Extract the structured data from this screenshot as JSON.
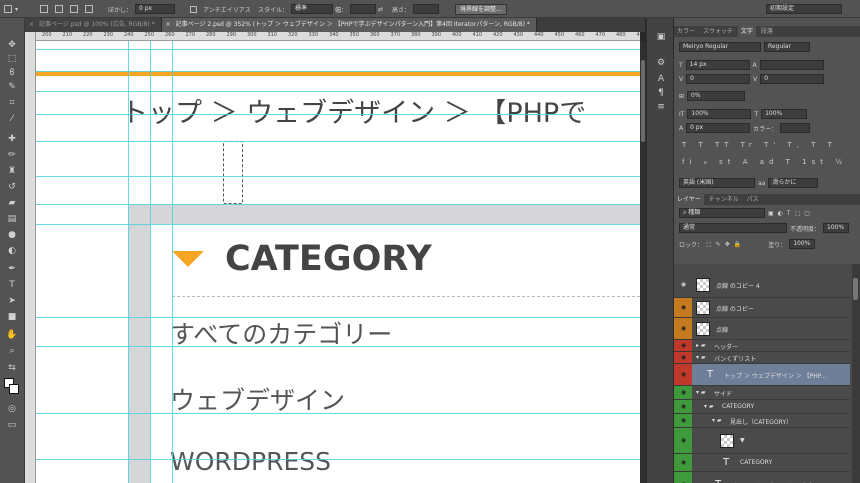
{
  "options_bar": {
    "feather_label": "ぼかし：",
    "feather_value": "0 px",
    "antialias_label": "アンチエイリアス",
    "style_label": "スタイル：",
    "style_value": "標準",
    "width_label": "幅：",
    "height_label": "高さ：",
    "refine_button": "境界線を調整...",
    "workspace": "初期設定"
  },
  "tabs": [
    {
      "label": "記事ページ.psd @ 100% (広告, RGB/8) *"
    },
    {
      "label": "記事ページ 2.psd @ 352% (トップ ＞ ウェブデザイン ＞ 【PHPで学ぶデザインパターン入門】第4回 Iteratorパターン, RGB/8) *"
    }
  ],
  "ruler": {
    "numbers": [
      "200",
      "210",
      "220",
      "230",
      "240",
      "250",
      "260",
      "270",
      "280",
      "290",
      "300",
      "310",
      "320",
      "330",
      "340",
      "350",
      "360",
      "370",
      "380",
      "390",
      "400",
      "410",
      "420",
      "430",
      "440",
      "450",
      "460",
      "470",
      "480",
      "490"
    ]
  },
  "canvas": {
    "breadcrumb": "トップ ＞ ウェブデザイン ＞ 【PHPで",
    "category_title": "CATEGORY",
    "category_items": [
      "すべてのカテゴリー",
      "ウェブデザイン",
      "WORDPRESS"
    ],
    "colors": {
      "accent": "#f5a623",
      "guide": "#4fd4e0",
      "text": "#444444"
    }
  },
  "character_panel": {
    "tabs": [
      "カラー",
      "スウォッチ",
      "文字",
      "段落"
    ],
    "active_tab": "文字",
    "font_family": "Meiryo Regular",
    "font_style": "Regular",
    "font_size": "14 px",
    "kerning": "0",
    "tracking": "0",
    "tsume": "0%",
    "vertical_scale": "100%",
    "horizontal_scale": "100%",
    "baseline": "0 px",
    "color_label": "カラー：",
    "style_glyphs": "T T TT Tr T' T, T T",
    "opentype_glyphs": "fi ℴ st A ad T 1st ½",
    "language": "英語 (米国)",
    "aa_label": "aa",
    "antialias": "滑らかに"
  },
  "layers_panel": {
    "tabs": [
      "レイヤー",
      "チャンネル",
      "パス"
    ],
    "active_tab": "レイヤー",
    "filter_kind": "種類",
    "blend_mode": "通常",
    "opacity_label": "不透明度：",
    "opacity": "100%",
    "lock_label": "ロック：",
    "fill_label": "塗り：",
    "fill": "100%",
    "layers": [
      {
        "name": "点線 のコピー 4",
        "kind": "pixel",
        "indent": 0,
        "vis_color": "#4a4a4a"
      },
      {
        "name": "点線 のコピー",
        "kind": "pixel",
        "indent": 0,
        "vis_color": "#c67a1f"
      },
      {
        "name": "点線",
        "kind": "pixel",
        "indent": 0,
        "vis_color": "#c67a1f"
      },
      {
        "name": "ヘッダー",
        "kind": "group-closed",
        "indent": 0,
        "vis_color": "#c0392b"
      },
      {
        "name": "パンくずリスト",
        "kind": "group-open",
        "indent": 0,
        "vis_color": "#c0392b"
      },
      {
        "name": "トップ ＞ ウェブデザイン ＞ 【PHP...",
        "kind": "text",
        "indent": 1,
        "vis_color": "#c0392b",
        "selected": true
      },
      {
        "name": "サイド",
        "kind": "group-open",
        "indent": 0,
        "vis_color": "#3f9a3c"
      },
      {
        "name": "CATEGORY",
        "kind": "group-open",
        "indent": 1,
        "vis_color": "#3f9a3c"
      },
      {
        "name": "見出し（CATEGORY）",
        "kind": "group-open",
        "indent": 2,
        "vis_color": "#3f9a3c"
      },
      {
        "name": "▼",
        "kind": "shape",
        "indent": 3,
        "vis_color": "#3f9a3c"
      },
      {
        "name": "CATEGORY",
        "kind": "text",
        "indent": 3,
        "vis_color": "#3f9a3c"
      },
      {
        "name": "すべてのカテゴリー ウェブデザイ...",
        "kind": "text",
        "indent": 2,
        "vis_color": "#3f9a3c"
      }
    ]
  }
}
